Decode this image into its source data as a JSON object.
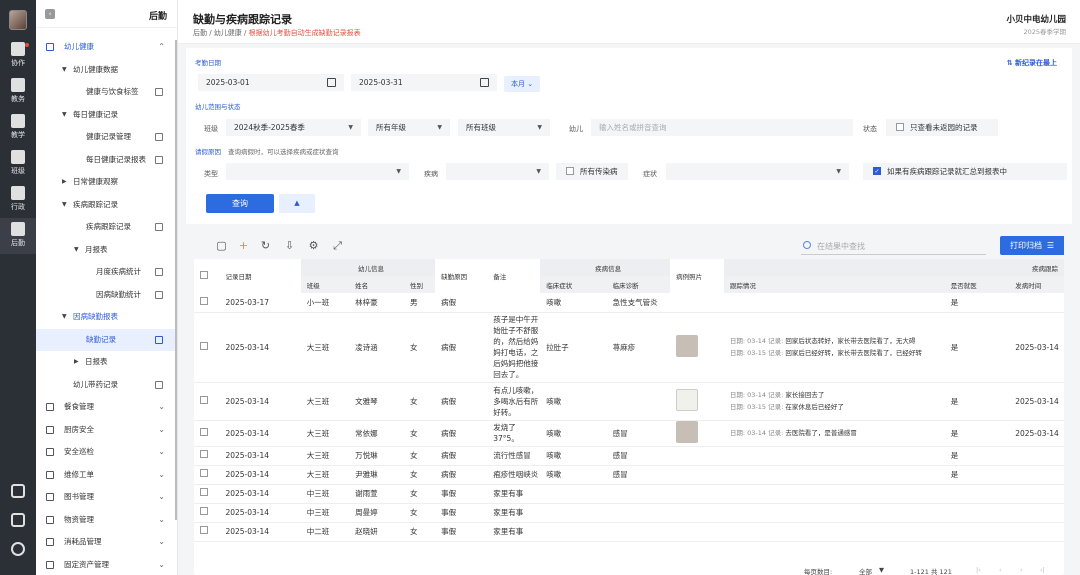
{
  "rail": {
    "items": [
      {
        "label": "协作",
        "icon": "grid-icon"
      },
      {
        "label": "教务",
        "icon": "clipboard-icon"
      },
      {
        "label": "教学",
        "icon": "tools-icon"
      },
      {
        "label": "班级",
        "icon": "class-icon"
      },
      {
        "label": "行政",
        "icon": "window-icon"
      },
      {
        "label": "后勤",
        "icon": "logistics-icon"
      }
    ]
  },
  "sidebar": {
    "title": "后勤",
    "items": [
      {
        "label": "幼儿健康"
      },
      {
        "label": "幼儿健康数据"
      },
      {
        "label": "健康与饮食标签"
      },
      {
        "label": "每日健康记录"
      },
      {
        "label": "健康记录管理"
      },
      {
        "label": "每日健康记录报表"
      },
      {
        "label": "日常健康观察"
      },
      {
        "label": "疾病跟踪记录"
      },
      {
        "label": "疾病跟踪记录"
      },
      {
        "label": "月报表"
      },
      {
        "label": "月度疾病统计"
      },
      {
        "label": "因病缺勤统计"
      },
      {
        "label": "因病缺勤报表"
      },
      {
        "label": "缺勤记录"
      },
      {
        "label": "日报表"
      },
      {
        "label": "幼儿带药记录"
      },
      {
        "label": "餐食管理"
      },
      {
        "label": "厨房安全"
      },
      {
        "label": "安全巡检"
      },
      {
        "label": "维修工单"
      },
      {
        "label": "图书管理"
      },
      {
        "label": "物资管理"
      },
      {
        "label": "消耗品管理"
      },
      {
        "label": "固定资产管理"
      }
    ]
  },
  "header": {
    "title": "缺勤与疾病跟踪记录",
    "crumb1": "后勤",
    "crumb2": "幼儿健康",
    "crumb_note": "根据幼儿考勤自动生成缺勤记录报表",
    "school": "小贝中电幼儿园",
    "term": "2025春季学期"
  },
  "filter": {
    "date_label": "考勤日期",
    "start_date": "2025-03-01",
    "end_date": "2025-03-31",
    "month_btn": "本月",
    "new_top": "新纪录在最上",
    "range_label": "幼儿范围与状态",
    "class_label": "班级",
    "term_value": "2024秋季-2025春季",
    "grade_value": "所有年级",
    "class_value": "所有班级",
    "child_label": "幼儿",
    "child_placeholder": "输入姓名或拼音查询",
    "status_label": "状态",
    "status_option": "只查看未返园的记录",
    "reason_label": "请假原因",
    "reason_hint": "查询病假时，可以选择疾病或症状查询",
    "type_label": "类型",
    "disease_label": "疾病",
    "all_infectious": "所有传染病",
    "symptom_label": "症状",
    "summary_option": "如果有疾病跟踪记录就汇总到报表中",
    "query_btn": "查询"
  },
  "table": {
    "search_placeholder": "在结果中查找",
    "print_btn": "打印归档",
    "headers": {
      "date": "记录日期",
      "child_info": "幼儿信息",
      "class": "班级",
      "name": "姓名",
      "gender": "性别",
      "reason": "缺勤原因",
      "note": "备注",
      "disease_info": "疾病信息",
      "symptom": "临床症状",
      "diagnosis": "临床诊断",
      "photo": "病例照片",
      "followup": "跟踪情况",
      "disease_track": "疾病跟踪",
      "returned": "是否就医",
      "onset": "发病时间"
    },
    "rows": [
      {
        "date": "2025-03-17",
        "class": "小一班",
        "name": "林梓豪",
        "gender": "男",
        "reason": "病假",
        "note": "",
        "symptom": "咳嗽",
        "diagnosis": "急性支气管炎",
        "photo": "",
        "track": [],
        "returned": "是",
        "onset": ""
      },
      {
        "date": "2025-03-14",
        "class": "大三班",
        "name": "凌诗涵",
        "gender": "女",
        "reason": "病假",
        "note": "孩子是中午开始肚子不舒服的，然后给妈妈打电话，之后妈妈把他接回去了。",
        "symptom": "拉肚子",
        "diagnosis": "荨麻疹",
        "photo": "photo",
        "track": [
          {
            "d": "日期: 03-14",
            "r": "记录: ",
            "t": "回家后状态转好，家长带去医院看了，无大碍"
          },
          {
            "d": "日期: 03-15",
            "r": "记录: ",
            "t": "回家后已经好转，家长带去医院看了，已经好转"
          }
        ],
        "returned": "是",
        "onset": "2025-03-14"
      },
      {
        "date": "2025-03-14",
        "class": "大三班",
        "name": "文雅琴",
        "gender": "女",
        "reason": "病假",
        "note": "有点儿咳嗽，多喝水后有所好转。",
        "symptom": "咳嗽",
        "diagnosis": "",
        "photo": "doc",
        "track": [
          {
            "d": "日期: 03-14",
            "r": "记录: ",
            "t": "家长接回去了"
          },
          {
            "d": "日期: 03-15",
            "r": "记录: ",
            "t": "在家休息后已经好了"
          }
        ],
        "returned": "是",
        "onset": "2025-03-14"
      },
      {
        "date": "2025-03-14",
        "class": "大三班",
        "name": "常依娜",
        "gender": "女",
        "reason": "病假",
        "note": "发烧了37°5。",
        "symptom": "咳嗽",
        "diagnosis": "感冒",
        "photo": "photo",
        "track": [
          {
            "d": "日期: 03-14",
            "r": "记录: ",
            "t": "去医院看了，是普通感冒"
          }
        ],
        "returned": "是",
        "onset": "2025-03-14"
      },
      {
        "date": "2025-03-14",
        "class": "大三班",
        "name": "万悦琳",
        "gender": "女",
        "reason": "病假",
        "note": "流行性感冒",
        "symptom": "咳嗽",
        "diagnosis": "感冒",
        "photo": "",
        "track": [],
        "returned": "是",
        "onset": ""
      },
      {
        "date": "2025-03-14",
        "class": "大三班",
        "name": "尹雅琳",
        "gender": "女",
        "reason": "病假",
        "note": "疱疹性咽峡炎",
        "symptom": "咳嗽",
        "diagnosis": "感冒",
        "photo": "",
        "track": [],
        "returned": "是",
        "onset": ""
      },
      {
        "date": "2025-03-14",
        "class": "中三班",
        "name": "谢雨萱",
        "gender": "女",
        "reason": "事假",
        "note": "家里有事",
        "symptom": "",
        "diagnosis": "",
        "photo": "",
        "track": [],
        "returned": "",
        "onset": ""
      },
      {
        "date": "2025-03-14",
        "class": "中三班",
        "name": "周曼婷",
        "gender": "女",
        "reason": "事假",
        "note": "家里有事",
        "symptom": "",
        "diagnosis": "",
        "photo": "",
        "track": [],
        "returned": "",
        "onset": ""
      },
      {
        "date": "2025-03-14",
        "class": "中二班",
        "name": "赵晓妍",
        "gender": "女",
        "reason": "事假",
        "note": "家里有事",
        "symptom": "",
        "diagnosis": "",
        "photo": "",
        "track": [],
        "returned": "",
        "onset": ""
      }
    ],
    "pager": {
      "per_page_label": "每页数目:",
      "per_page_value": "全部",
      "range": "1-121 共 121"
    }
  }
}
